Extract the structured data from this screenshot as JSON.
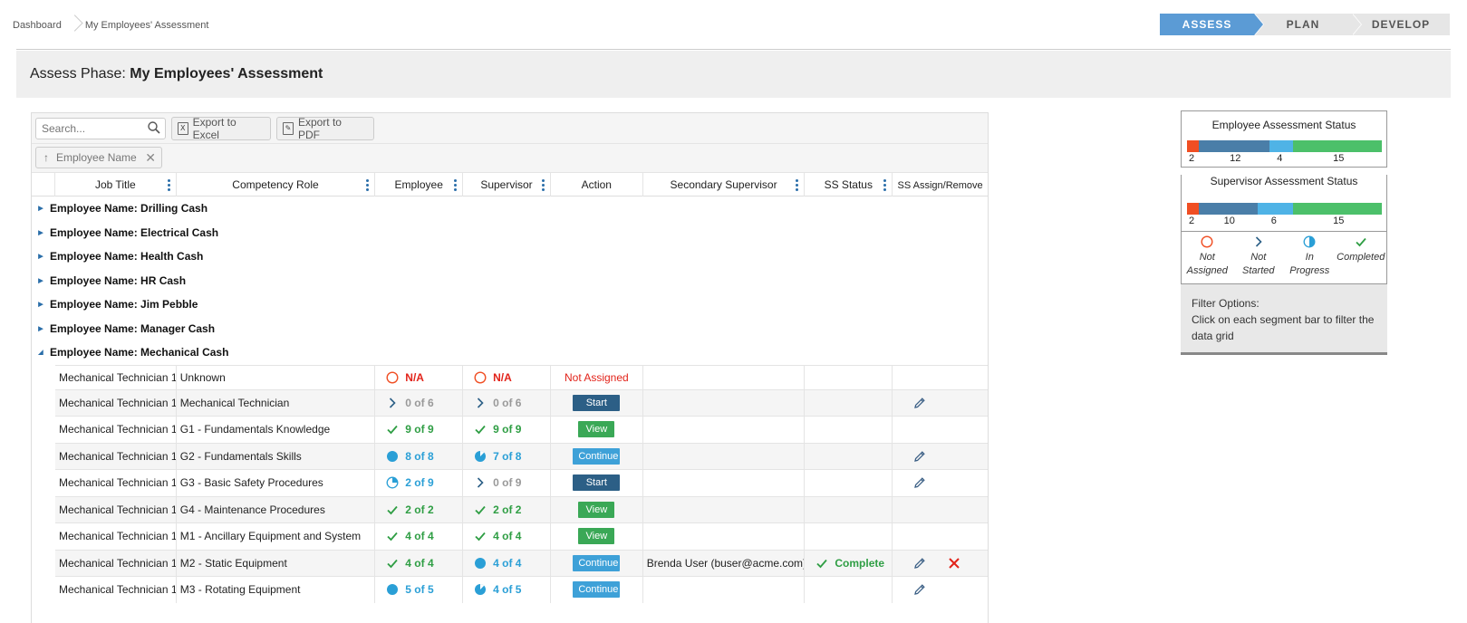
{
  "breadcrumb": {
    "items": [
      "Dashboard",
      "My Employees' Assessment"
    ]
  },
  "phases": [
    {
      "label": "ASSESS",
      "active": true
    },
    {
      "label": "PLAN",
      "active": false
    },
    {
      "label": "DEVELOP",
      "active": false
    }
  ],
  "page": {
    "title_prefix": "Assess Phase:",
    "title_main": "My Employees' Assessment"
  },
  "toolbar": {
    "search_placeholder": "Search...",
    "export_excel": "Export to Excel",
    "export_pdf": "Export to PDF"
  },
  "grouping": {
    "chip_label": "Employee Name"
  },
  "columns": {
    "job_title": "Job Title",
    "competency_role": "Competency Role",
    "employee": "Employee",
    "supervisor": "Supervisor",
    "action": "Action",
    "secondary_supervisor": "Secondary Supervisor",
    "ss_status": "SS Status",
    "ss_assign": "SS Assign/Remove"
  },
  "groups": [
    "Employee Name: Drilling Cash",
    "Employee Name: Electrical Cash",
    "Employee Name: Health Cash",
    "Employee Name: HR Cash",
    "Employee Name: Jim Pebble",
    "Employee Name: Manager Cash",
    "Employee Name: Mechanical Cash"
  ],
  "rows": [
    {
      "job": "Mechanical Technician 1",
      "role": "Unknown",
      "emp": "N/A",
      "emp_state": "not-assigned",
      "sup": "N/A",
      "sup_state": "not-assigned",
      "action": "Not Assigned",
      "action_type": "text",
      "sec": "",
      "ss": "",
      "pencil": false,
      "remove": false
    },
    {
      "job": "Mechanical Technician 1",
      "role": "Mechanical Technician",
      "emp": "0 of 6",
      "emp_state": "not-started",
      "sup": "0 of 6",
      "sup_state": "not-started",
      "action": "Start",
      "action_type": "start",
      "sec": "",
      "ss": "",
      "pencil": true,
      "remove": false
    },
    {
      "job": "Mechanical Technician 1",
      "role": "G1 - Fundamentals Knowledge",
      "emp": "9 of 9",
      "emp_state": "completed",
      "sup": "9 of 9",
      "sup_state": "completed",
      "action": "View",
      "action_type": "view",
      "sec": "",
      "ss": "",
      "pencil": false,
      "remove": false
    },
    {
      "job": "Mechanical Technician 1",
      "role": "G2 - Fundamentals Skills",
      "emp": "8 of 8",
      "emp_state": "in-progress-full",
      "sup": "7 of 8",
      "sup_state": "in-progress-most",
      "action": "Continue",
      "action_type": "continue",
      "sec": "",
      "ss": "",
      "pencil": true,
      "remove": false
    },
    {
      "job": "Mechanical Technician 1",
      "role": "G3 - Basic Safety Procedures",
      "emp": "2 of 9",
      "emp_state": "in-progress-low",
      "sup": "0 of 9",
      "sup_state": "not-started",
      "action": "Start",
      "action_type": "start",
      "sec": "",
      "ss": "",
      "pencil": true,
      "remove": false
    },
    {
      "job": "Mechanical Technician 1",
      "role": "G4 - Maintenance Procedures",
      "emp": "2 of 2",
      "emp_state": "completed",
      "sup": "2 of 2",
      "sup_state": "completed",
      "action": "View",
      "action_type": "view",
      "sec": "",
      "ss": "",
      "pencil": false,
      "remove": false
    },
    {
      "job": "Mechanical Technician 1",
      "role": "M1 - Ancillary Equipment and System",
      "emp": "4 of 4",
      "emp_state": "completed",
      "sup": "4 of 4",
      "sup_state": "completed",
      "action": "View",
      "action_type": "view",
      "sec": "",
      "ss": "",
      "pencil": false,
      "remove": false
    },
    {
      "job": "Mechanical Technician 1",
      "role": "M2 - Static Equipment",
      "emp": "4 of 4",
      "emp_state": "completed",
      "sup": "4 of 4",
      "sup_state": "in-progress-full",
      "action": "Continue",
      "action_type": "continue",
      "sec": "Brenda User (buser@acme.com)",
      "ss": "Complete",
      "pencil": true,
      "remove": true
    },
    {
      "job": "Mechanical Technician 1",
      "role": "M3 - Rotating Equipment",
      "emp": "5 of 5",
      "emp_state": "in-progress-full",
      "sup": "4 of 5",
      "sup_state": "in-progress-most",
      "action": "Continue",
      "action_type": "continue",
      "sec": "",
      "ss": "",
      "pencil": true,
      "remove": false
    }
  ],
  "status_panel": {
    "employee_title": "Employee Assessment Status",
    "employee_counts": [
      2,
      12,
      4,
      15
    ],
    "supervisor_title": "Supervisor Assessment Status",
    "supervisor_counts": [
      2,
      10,
      6,
      15
    ],
    "legend": [
      {
        "icon": "not-assigned-icon",
        "line1": "Not",
        "line2": "Assigned"
      },
      {
        "icon": "not-started-icon",
        "line1": "Not",
        "line2": "Started"
      },
      {
        "icon": "in-progress-icon",
        "line1": "In",
        "line2": "Progress"
      },
      {
        "icon": "completed-icon",
        "line1": "Completed",
        "line2": ""
      }
    ],
    "filter_title": "Filter Options:",
    "filter_text": "Click on each segment bar to filter the data grid",
    "colors": {
      "not_assigned": "#f04e23",
      "not_started": "#4a7ea8",
      "in_progress": "#4fb3e6",
      "completed": "#4cc06a"
    }
  }
}
